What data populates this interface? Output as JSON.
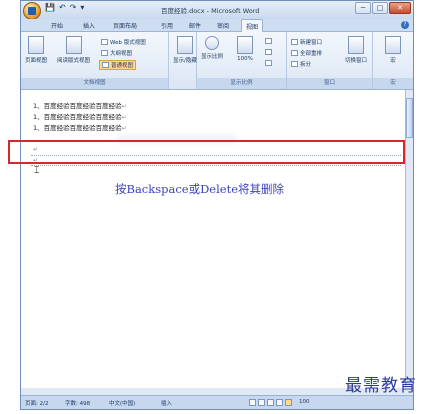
{
  "window": {
    "title": "百度经验.docx - Microsoft Word",
    "quick_access": [
      "💾",
      "↶",
      "↷",
      "▾"
    ],
    "buttons": [
      "─",
      "□",
      "✕"
    ]
  },
  "tabs": [
    "开始",
    "插入",
    "页面布局",
    "引用",
    "邮件",
    "审阅",
    "视图"
  ],
  "ribbon": {
    "doc_views": {
      "label": "文档视图",
      "page_view": "页面视图",
      "read_view": "阅读版式视图",
      "web_view": "Web 版式视图",
      "outline": "大纲视图",
      "draft": "普通视图"
    },
    "show_hide": {
      "label": "显示/隐藏"
    },
    "zoom": {
      "label": "显示比例",
      "zoom_btn": "显示比例",
      "percent": "100%"
    },
    "window": {
      "label": "窗口",
      "new_window": "新建窗口",
      "arrange_all": "全部重排",
      "split": "拆分",
      "switch": "切换窗口"
    },
    "macro": {
      "label": "宏",
      "btn": "宏"
    }
  },
  "document": {
    "lines": [
      "1、百度经验百度经验百度经验",
      "1、百度经验百度经验百度经验",
      "1、百度经验百度经验百度经验"
    ],
    "para_mark": "↵",
    "cursor_mark": "↵",
    "instruction": "按Backspace或Delete将其删除"
  },
  "status": {
    "page": "页面: 2/2",
    "words": "字数: 498",
    "language": "中文(中国)",
    "mode": "插入",
    "zoom": "100"
  },
  "watermark": "最需教育"
}
